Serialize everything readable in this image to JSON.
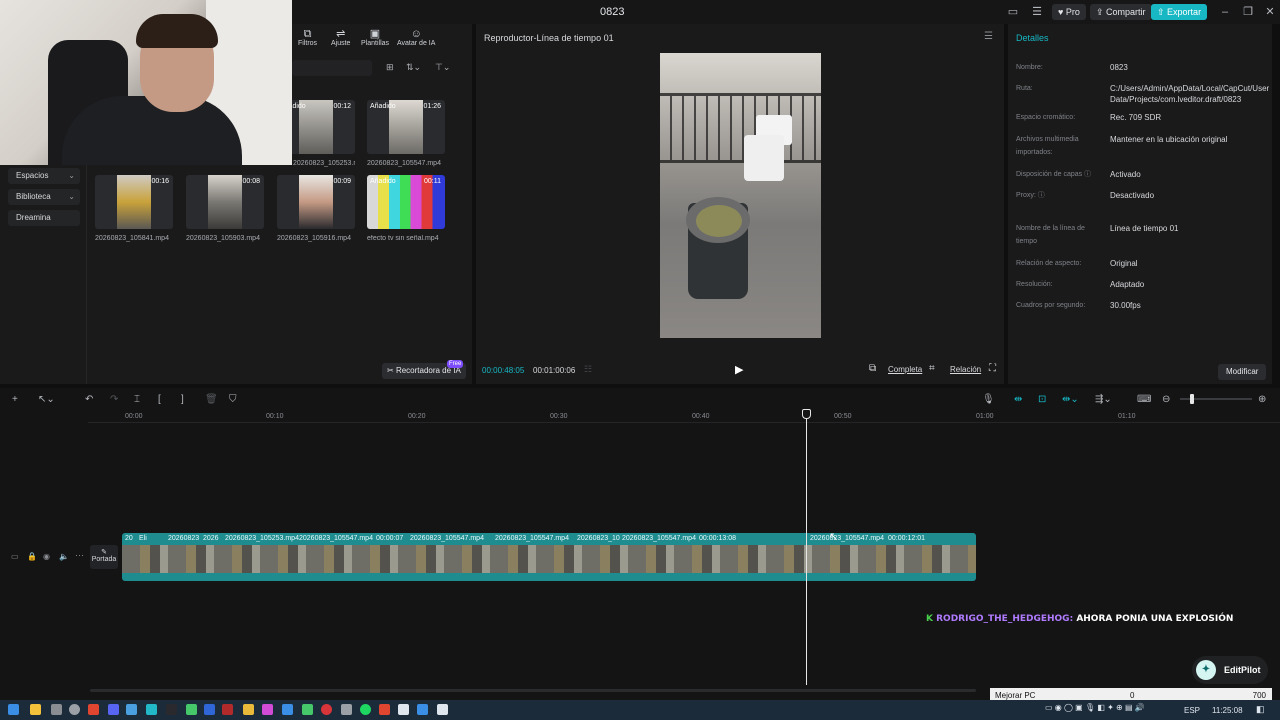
{
  "window": {
    "title": "0823",
    "pro": "Pro",
    "share": "Compartir",
    "export": "Exportar"
  },
  "media": {
    "toolbar": [
      "Filtros",
      "Ajuste",
      "Plantillas",
      "Avatar de IA"
    ],
    "nav": [
      "Espacios",
      "Biblioteca",
      "Dreamina"
    ],
    "clips_row1": [
      {
        "tag": "Añadido",
        "duration": "00:12",
        "name": "20260823_105253.mp4"
      },
      {
        "tag": "Añadido",
        "duration": "01:26",
        "name": "20260823_105547.mp4"
      }
    ],
    "clips_row2": [
      {
        "tag": "",
        "duration": "00:16",
        "name": "20260823_105841.mp4"
      },
      {
        "tag": "",
        "duration": "00:08",
        "name": "20260823_105903.mp4"
      },
      {
        "tag": "",
        "duration": "00:09",
        "name": "20260823_105916.mp4"
      },
      {
        "tag": "Añadido",
        "duration": "00:11",
        "name": "efecto tv sin señal.mp4"
      }
    ],
    "ai_cropper": "Recortadora de IA",
    "free_badge": "Free"
  },
  "player": {
    "title": "Reproductor-Línea de tiempo 01",
    "current_time": "00:00:48:05",
    "total_time": "00:01:00:06",
    "full_label": "Completa",
    "ratio_label": "Relación"
  },
  "details": {
    "title": "Detalles",
    "rows": [
      {
        "label": "Nombre:",
        "value": "0823"
      },
      {
        "label": "Ruta:",
        "value": "C:/Users/Admin/AppData/Local/CapCut/User Data/Projects/com.lveditor.draft/0823"
      },
      {
        "label": "Espacio cromático:",
        "value": "Rec. 709 SDR"
      },
      {
        "label": "Archivos multimedia importados:",
        "value": "Mantener en la ubicación original"
      },
      {
        "label": "Disposición de capas ⓘ",
        "value": "Activado"
      },
      {
        "label": "Proxy: ⓘ",
        "value": "Desactivado"
      },
      {
        "label": "Nombre de la línea de tiempo",
        "value": "Línea de tiempo 01"
      },
      {
        "label": "Relación de aspecto:",
        "value": "Original"
      },
      {
        "label": "Resolución:",
        "value": "Adaptado"
      },
      {
        "label": "Cuadros por segundo:",
        "value": "30.00fps"
      }
    ],
    "modify": "Modificar"
  },
  "timeline": {
    "ruler": [
      "00:00",
      "00:10",
      "00:20",
      "00:30",
      "00:40",
      "00:50",
      "01:00",
      "01:10"
    ],
    "cover": "Portada",
    "track_labels": [
      "20",
      "Eli",
      "20260823",
      "2026",
      "20260823_105253.mp4",
      "20260823_105547.mp4",
      "00:00:07",
      "20260823_105547.mp4",
      "20260823_105547.mp4",
      "20260823_10",
      "20260823_105547.mp4",
      "00:00:13:08",
      "20260823_105547.mp4",
      "00:00:12:01"
    ]
  },
  "chat": {
    "badge": "K",
    "user": "RODRIGO_THE_HEDGEHOG:",
    "message": "AHORA PONIA UNA EXPLOSIÓN"
  },
  "editpilot": "EditPilot",
  "status": {
    "label": "Mejorar PC",
    "value1": "0",
    "value2": "700"
  },
  "taskbar": {
    "lang": "ESP",
    "clock": "11:25:08"
  }
}
